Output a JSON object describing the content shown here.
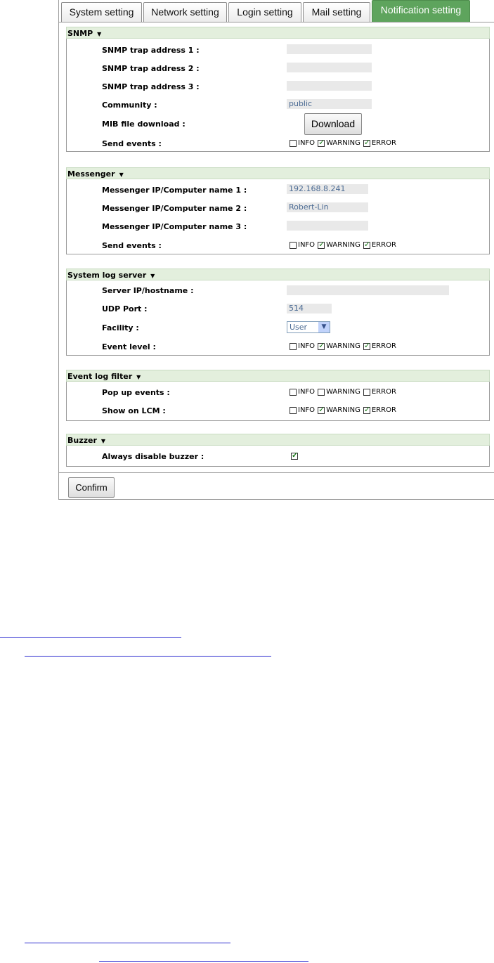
{
  "tabs": [
    "System setting",
    "Network setting",
    "Login setting",
    "Mail setting",
    "Notification setting"
  ],
  "active_tab": "Notification setting",
  "snmp": {
    "title": "SNMP",
    "labels": {
      "trap1": "SNMP trap address 1 :",
      "trap2": "SNMP trap address 2 :",
      "trap3": "SNMP trap address 3 :",
      "community": "Community :",
      "mib": "MIB file download :",
      "send_events": "Send events :"
    },
    "values": {
      "trap1": "",
      "trap2": "",
      "trap3": "",
      "community": "public"
    },
    "download_label": "Download",
    "events": {
      "info": false,
      "warning": true,
      "error": true
    }
  },
  "messenger": {
    "title": "Messenger",
    "labels": {
      "m1": "Messenger IP/Computer name 1 :",
      "m2": "Messenger IP/Computer name 2 :",
      "m3": "Messenger IP/Computer name 3 :",
      "send_events": "Send events :"
    },
    "values": {
      "m1": "192.168.8.241",
      "m2": "Robert-Lin",
      "m3": ""
    },
    "events": {
      "info": false,
      "warning": true,
      "error": true
    }
  },
  "syslog": {
    "title": "System log server",
    "labels": {
      "server": "Server IP/hostname :",
      "udp": "UDP Port :",
      "facility": "Facility :",
      "level": "Event level :"
    },
    "values": {
      "server": "",
      "udp": "514",
      "facility": "User"
    },
    "events": {
      "info": false,
      "warning": true,
      "error": true
    }
  },
  "eventlog": {
    "title": "Event log filter",
    "labels": {
      "popup": "Pop up events :",
      "lcm": "Show on LCM :"
    },
    "popup": {
      "info": false,
      "warning": false,
      "error": false
    },
    "lcm": {
      "info": false,
      "warning": true,
      "error": true
    }
  },
  "buzzer": {
    "title": "Buzzer",
    "labels": {
      "disable": "Always disable buzzer :"
    },
    "disable": true
  },
  "event_labels": {
    "info": "INFO",
    "warning": "WARNING",
    "error": "ERROR"
  },
  "confirm_label": "Confirm",
  "colors": {
    "active_tab": "#5ea45d",
    "section_header": "#e3efdd",
    "field_bg": "#e9e9e9",
    "link": "#2c2ccf"
  }
}
